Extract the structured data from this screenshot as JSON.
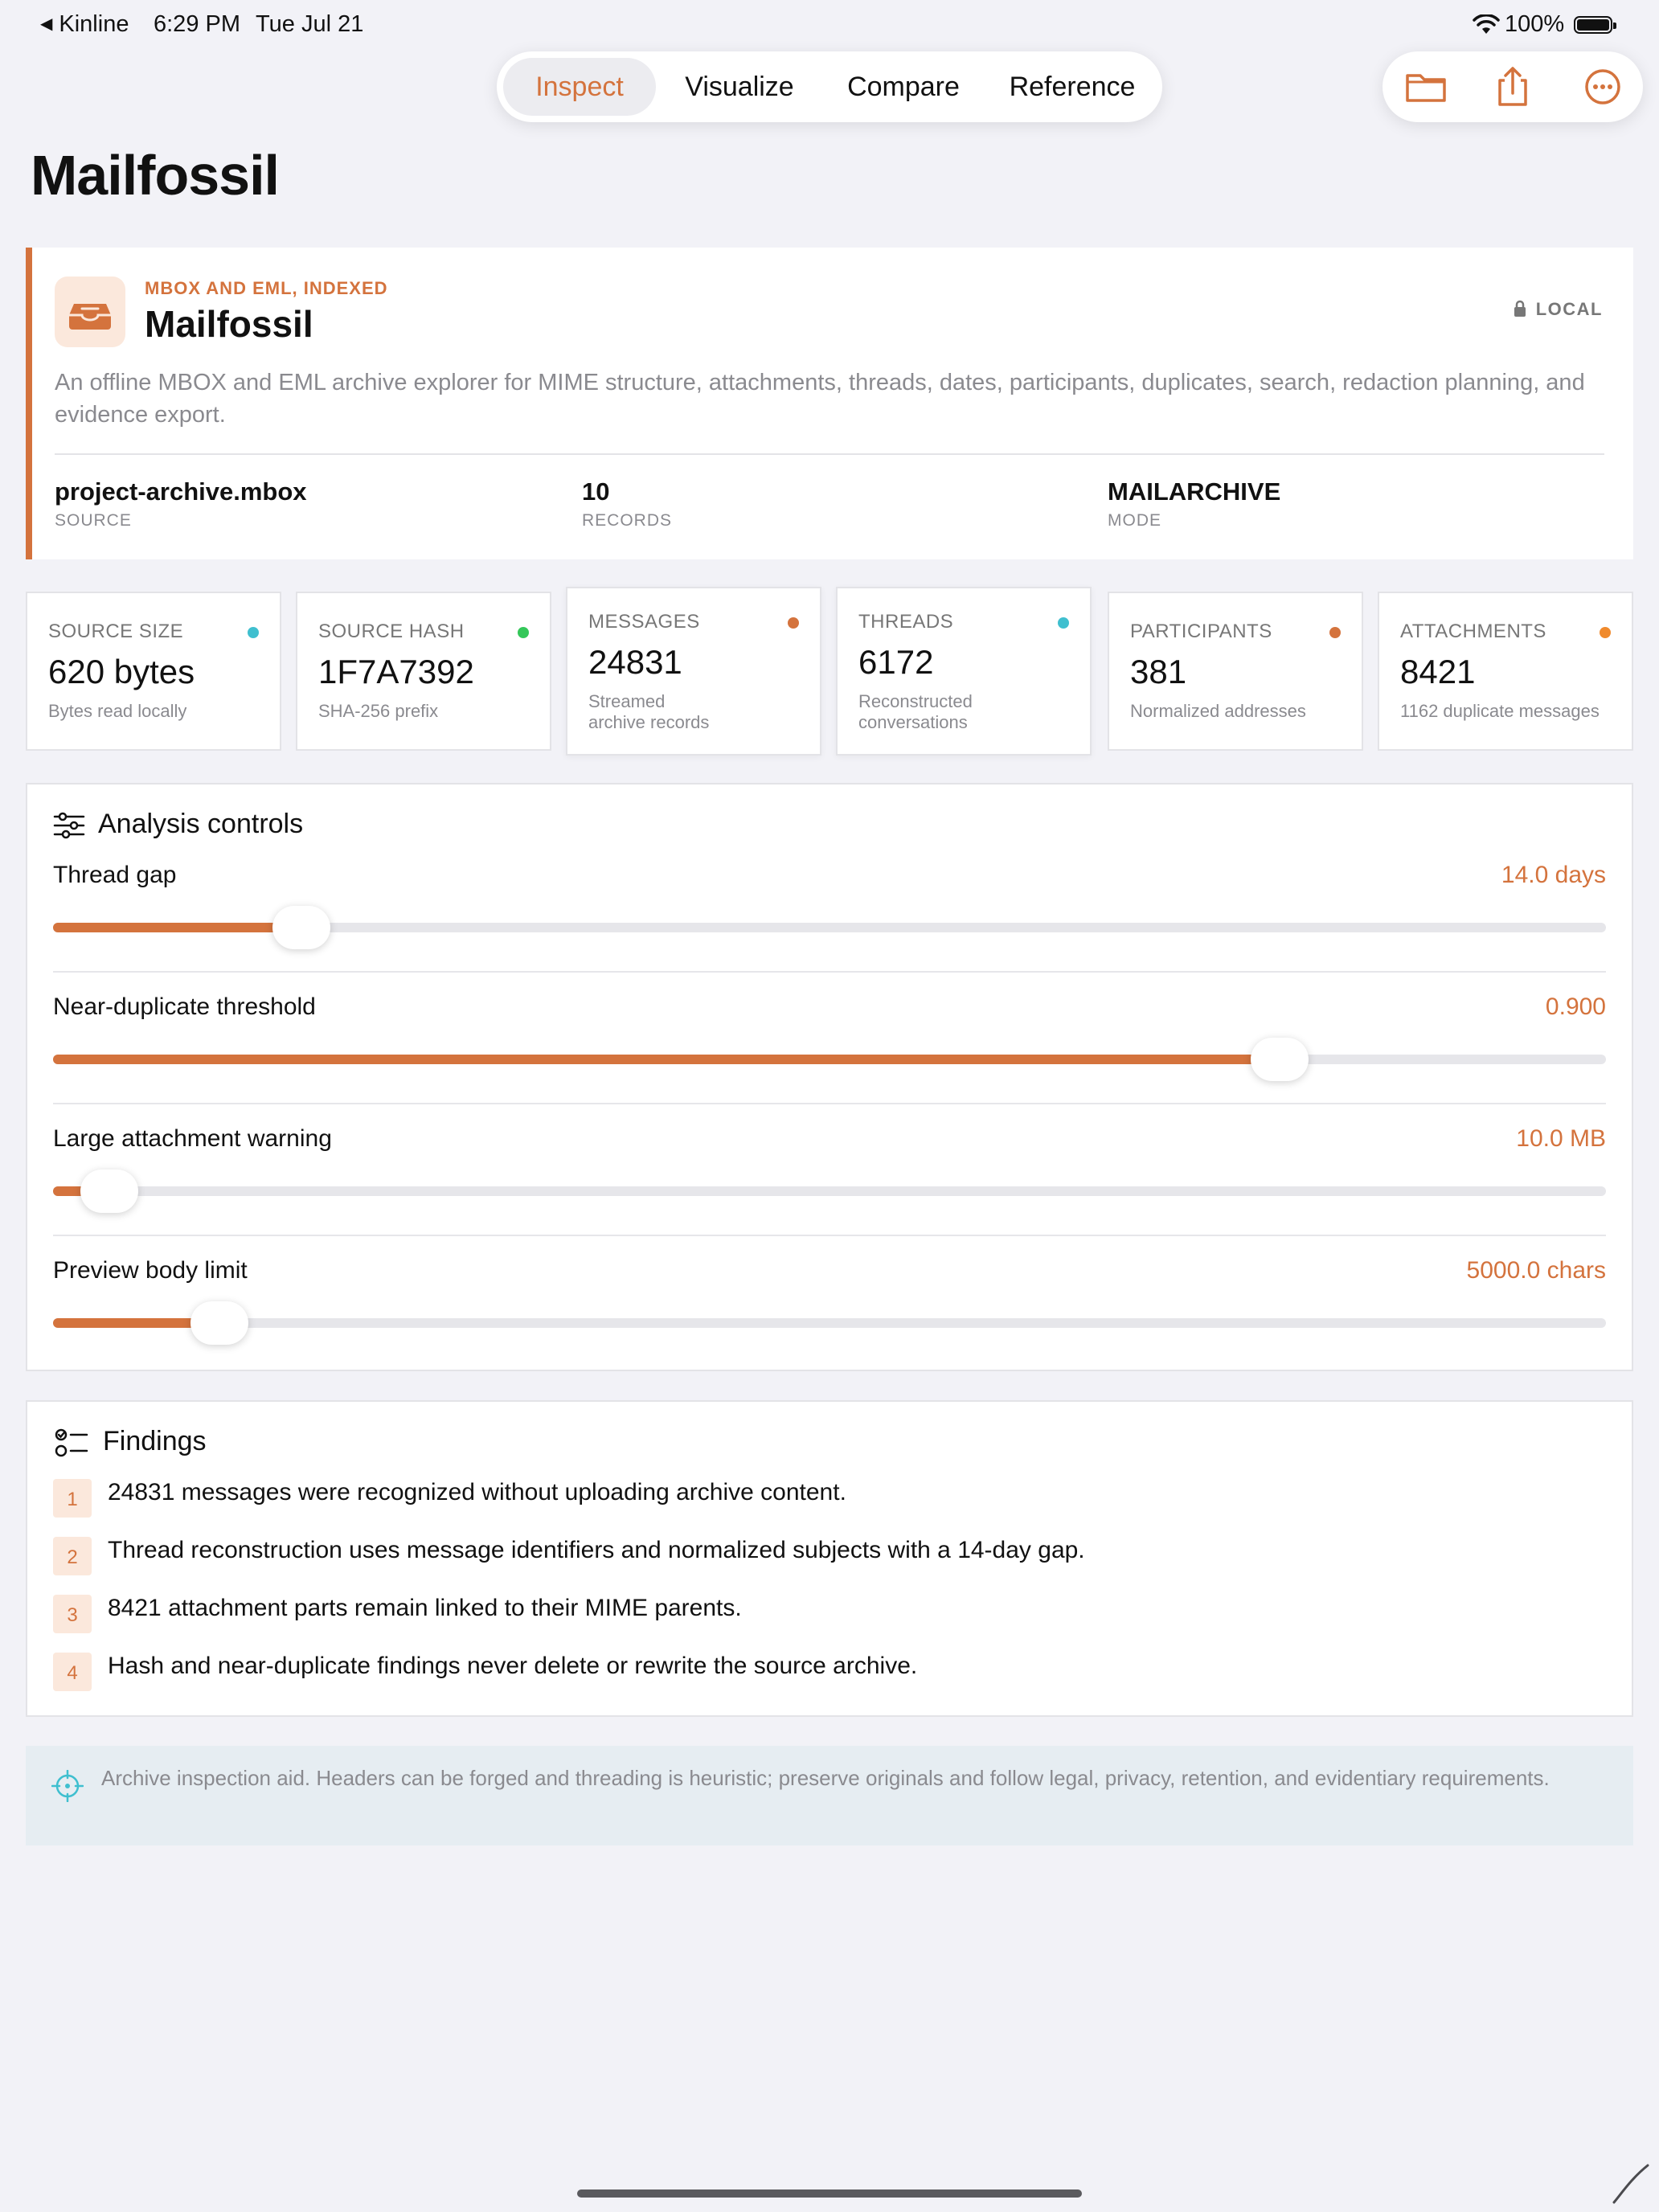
{
  "status_bar": {
    "back_app": "Kinline",
    "time": "6:29 PM",
    "date": "Tue Jul 21",
    "battery": "100%"
  },
  "nav": {
    "tabs": [
      {
        "label": "Inspect",
        "active": true
      },
      {
        "label": "Visualize",
        "active": false
      },
      {
        "label": "Compare",
        "active": false
      },
      {
        "label": "Reference",
        "active": false
      }
    ],
    "actions": [
      "folder-icon",
      "share-icon",
      "more-icon"
    ]
  },
  "page": {
    "title": "Mailfossil"
  },
  "hero": {
    "eyebrow": "MBOX AND EML, INDEXED",
    "name": "Mailfossil",
    "badge": "LOCAL",
    "description": "An offline MBOX and EML archive explorer for MIME structure, attachments, threads, dates, participants, duplicates, search, redaction planning, and evidence export.",
    "meta": [
      {
        "value": "project-archive.mbox",
        "label": "SOURCE"
      },
      {
        "value": "10",
        "label": "RECORDS"
      },
      {
        "value": "MAILARCHIVE",
        "label": "MODE"
      }
    ]
  },
  "stats": [
    {
      "label": "SOURCE SIZE",
      "value": "620 bytes",
      "sub": "Bytes read locally",
      "dot_color": "#3fbfcf"
    },
    {
      "label": "SOURCE HASH",
      "value": "1F7A7392",
      "sub": "SHA-256 prefix",
      "dot_color": "#34c759"
    },
    {
      "label": "MESSAGES",
      "value": "24831",
      "sub": "Streamed\narchive records",
      "dot_color": "#d4733d"
    },
    {
      "label": "THREADS",
      "value": "6172",
      "sub": "Reconstructed\nconversations",
      "dot_color": "#3fbfcf"
    },
    {
      "label": "PARTICIPANTS",
      "value": "381",
      "sub": "Normalized addresses",
      "dot_color": "#d4733d"
    },
    {
      "label": "ATTACHMENTS",
      "value": "8421",
      "sub": "1162 duplicate messages",
      "dot_color": "#f08a2c"
    }
  ],
  "controls": {
    "title": "Analysis controls",
    "items": [
      {
        "label": "Thread gap",
        "value": "14.0 days",
        "fraction": 0.16
      },
      {
        "label": "Near-duplicate threshold",
        "value": "0.900",
        "fraction": 0.79
      },
      {
        "label": "Large attachment warning",
        "value": "10.0 MB",
        "fraction": 0.036
      },
      {
        "label": "Preview body limit",
        "value": "5000.0 chars",
        "fraction": 0.107
      }
    ]
  },
  "findings": {
    "title": "Findings",
    "items": [
      {
        "num": "1",
        "text": "24831 messages were recognized without uploading archive content."
      },
      {
        "num": "2",
        "text": "Thread reconstruction uses message identifiers and normalized subjects with a 14-day gap."
      },
      {
        "num": "3",
        "text": "8421 attachment parts remain linked to their MIME parents."
      },
      {
        "num": "4",
        "text": "Hash and near-duplicate findings never delete or rewrite the source archive."
      }
    ]
  },
  "disclaimer": "Archive inspection aid. Headers can be forged and threading is heuristic; preserve originals and follow legal, privacy, retention, and evidentiary requirements.",
  "colors": {
    "accent": "#d4733d",
    "background": "#f2f2f7",
    "teal": "#3fbfcf"
  }
}
